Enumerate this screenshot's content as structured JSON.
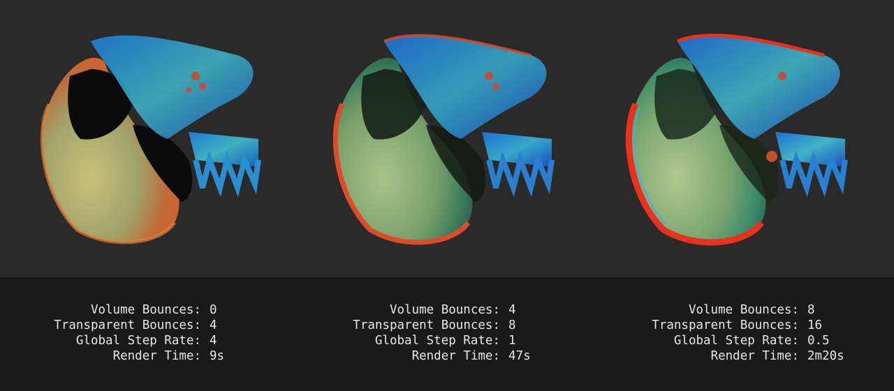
{
  "panels": [
    {
      "volume_bounces_label": "Volume Bounces:",
      "volume_bounces": "0",
      "transparent_bounces_label": "Transparent Bounces:",
      "transparent_bounces": "4",
      "global_step_rate_label": "Global Step Rate:",
      "global_step_rate": "4",
      "render_time_label": "Render Time:",
      "render_time": "9s"
    },
    {
      "volume_bounces_label": "Volume Bounces:",
      "volume_bounces": "4",
      "transparent_bounces_label": "Transparent Bounces:",
      "transparent_bounces": "8",
      "global_step_rate_label": "Global Step Rate:",
      "global_step_rate": "1",
      "render_time_label": "Render Time:",
      "render_time": "47s"
    },
    {
      "volume_bounces_label": "Volume Bounces:",
      "volume_bounces": "8",
      "transparent_bounces_label": "Transparent Bounces:",
      "transparent_bounces": "16",
      "global_step_rate_label": "Global Step Rate:",
      "global_step_rate": "0.5",
      "render_time_label": "Render Time:",
      "render_time": "2m20s"
    }
  ],
  "colors": {
    "render_background": "#2a2a2a",
    "caption_background": "#1a1a1a",
    "caption_text": "#e6e6e6"
  }
}
